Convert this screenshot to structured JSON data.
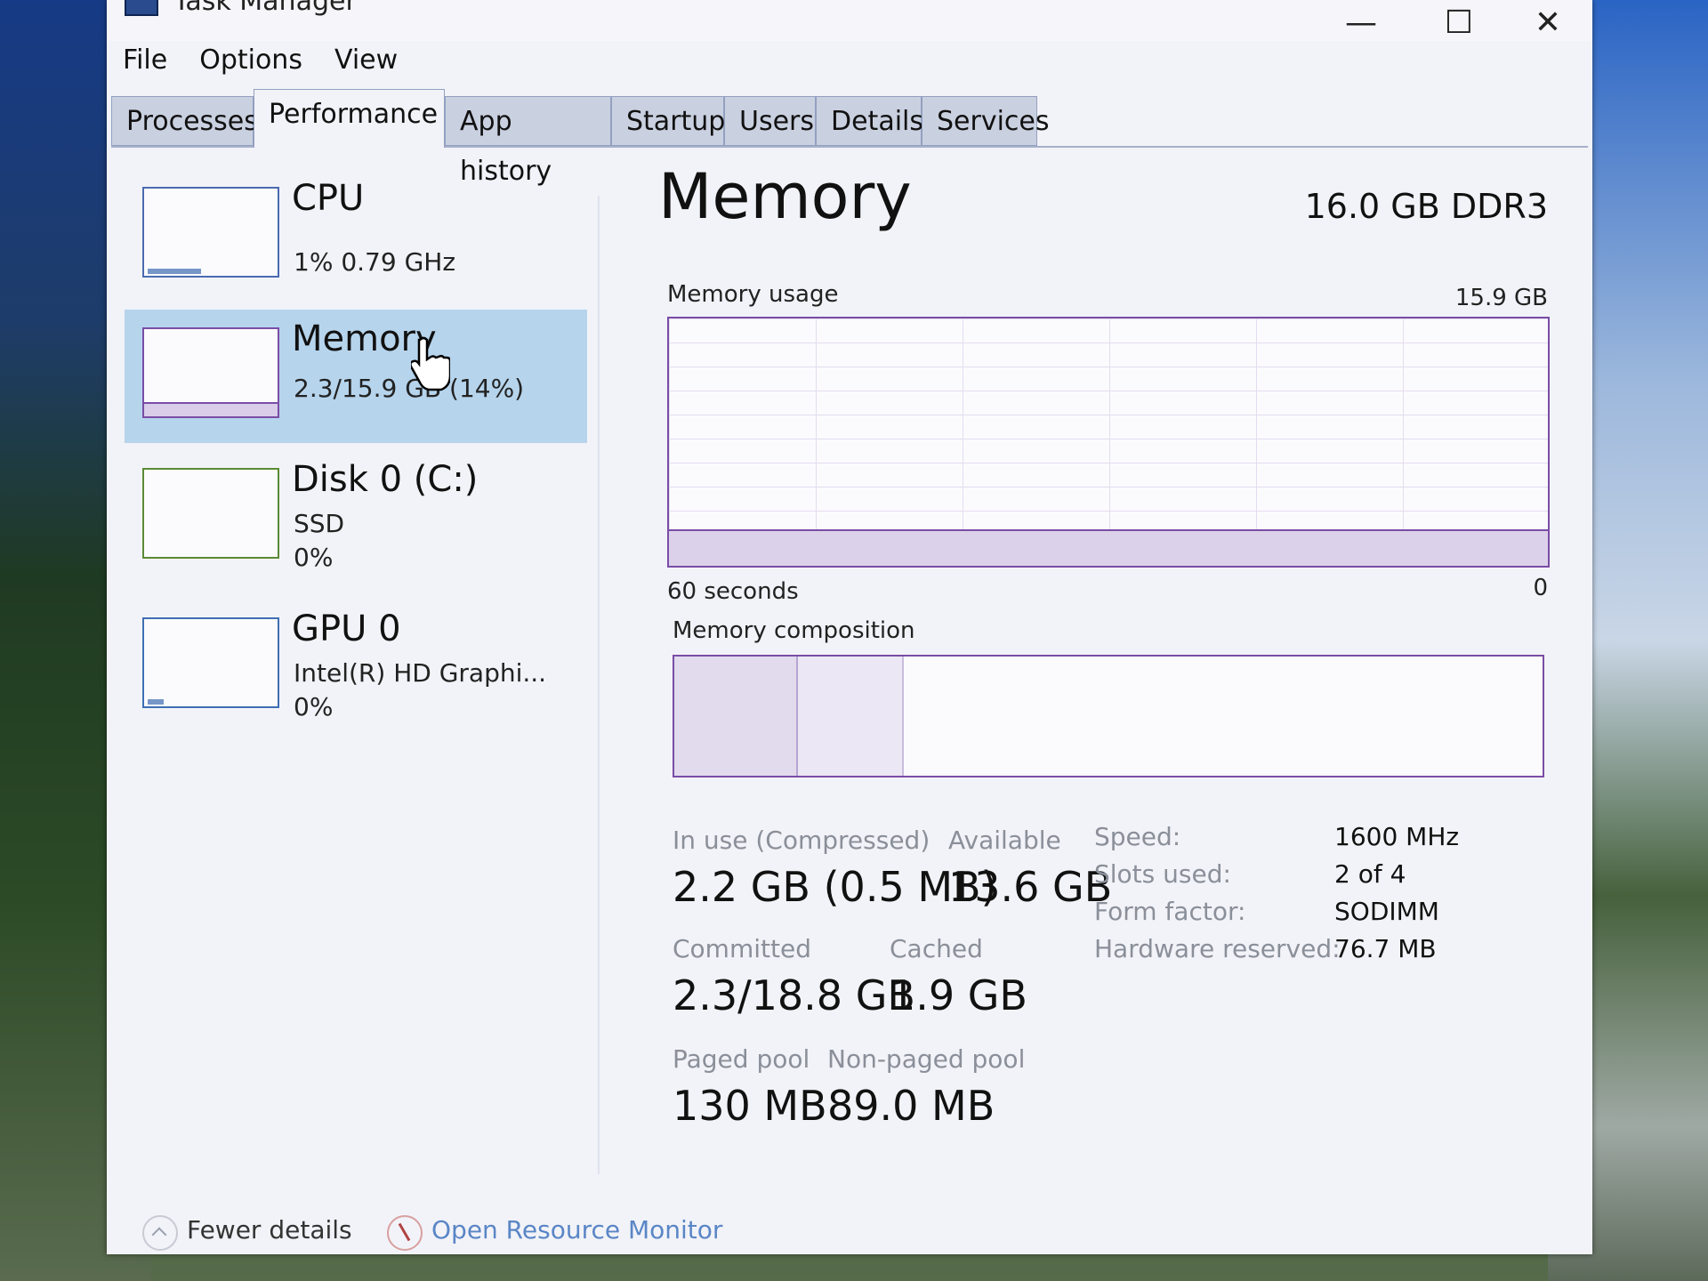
{
  "window": {
    "title": "Task Manager",
    "controls": {
      "minimize": "—",
      "maximize": "☐",
      "close": "✕"
    }
  },
  "menu": [
    "File",
    "Options",
    "View"
  ],
  "tabs": [
    "Processes",
    "Performance",
    "App history",
    "Startup",
    "Users",
    "Details",
    "Services"
  ],
  "active_tab": "Performance",
  "sidebar": {
    "cpu": {
      "name": "CPU",
      "detail": "1% 0.79 GHz"
    },
    "memory": {
      "name": "Memory",
      "detail": "2.3/15.9 GB (14%)",
      "usage_fraction": 0.14
    },
    "disk": {
      "name": "Disk 0 (C:)",
      "type": "SSD",
      "usage": "0%"
    },
    "gpu": {
      "name": "GPU 0",
      "model": "Intel(R) HD Graphi...",
      "usage": "0%"
    }
  },
  "detail": {
    "title": "Memory",
    "spec": "16.0 GB DDR3",
    "usage_label": "Memory usage",
    "usage_max": "15.9 GB",
    "time_left": "60 seconds",
    "time_right": "0",
    "usage_fraction": 0.14,
    "composition_label": "Memory composition",
    "composition": {
      "in_use_fraction": 0.14,
      "modified_fraction": 0.0,
      "standby_fraction": 0.12
    },
    "stats": {
      "in_use_label": "In use (Compressed)",
      "in_use": "2.2 GB (0.5 MB)",
      "available_label": "Available",
      "available": "13.6 GB",
      "committed_label": "Committed",
      "committed": "2.3/18.8 GB",
      "cached_label": "Cached",
      "cached": "1.9 GB",
      "paged_label": "Paged pool",
      "paged": "130 MB",
      "nonpaged_label": "Non-paged pool",
      "nonpaged": "89.0 MB"
    },
    "specs": {
      "speed_label": "Speed:",
      "speed": "1600 MHz",
      "slots_label": "Slots used:",
      "slots": "2 of 4",
      "form_label": "Form factor:",
      "form": "SODIMM",
      "reserved_label": "Hardware reserved:",
      "reserved": "76.7 MB"
    }
  },
  "footer": {
    "fewer_details": "Fewer details",
    "resource_monitor": "Open Resource Monitor"
  },
  "colors": {
    "memory_accent": "#7a4da6",
    "selected_bg": "#b6d4ec",
    "link": "#5a86c6"
  }
}
